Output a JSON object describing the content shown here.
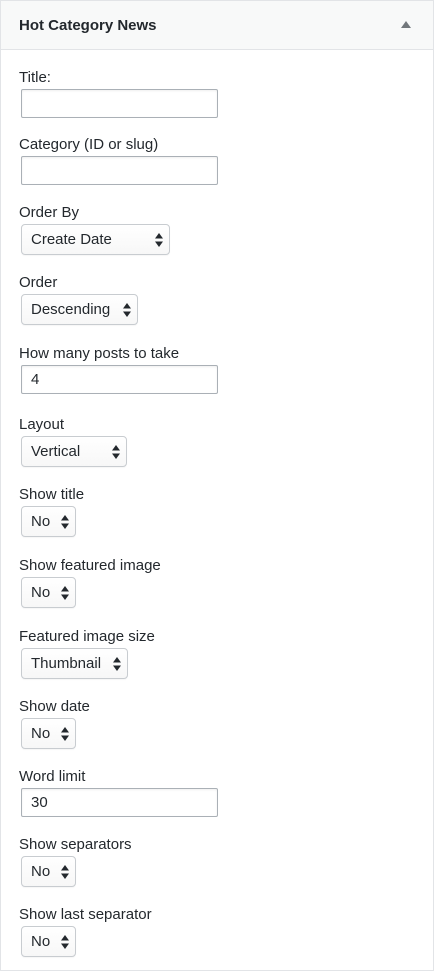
{
  "widget": {
    "title": "Hot Category News"
  },
  "fields": {
    "title": {
      "label": "Title:",
      "value": ""
    },
    "category": {
      "label": "Category (ID or slug)",
      "value": ""
    },
    "order_by": {
      "label": "Order By",
      "value": "Create Date"
    },
    "order": {
      "label": "Order",
      "value": "Descending"
    },
    "posts_count": {
      "label": "How many posts to take",
      "value": "4"
    },
    "layout": {
      "label": "Layout",
      "value": "Vertical"
    },
    "show_title": {
      "label": "Show title",
      "value": "No"
    },
    "show_featured_image": {
      "label": "Show featured image",
      "value": "No"
    },
    "featured_image_size": {
      "label": "Featured image size",
      "value": "Thumbnail"
    },
    "show_date": {
      "label": "Show date",
      "value": "No"
    },
    "word_limit": {
      "label": "Word limit",
      "value": "30"
    },
    "show_separators": {
      "label": "Show separators",
      "value": "No"
    },
    "show_last_separator": {
      "label": "Show last separator",
      "value": "No"
    }
  },
  "icons": {
    "collapse": "triangle-up-icon",
    "select_arrows": "up-down-arrows-icon"
  },
  "colors": {
    "header_bg": "#f8f9f9",
    "border": "#e2e4e7",
    "text": "#23282d",
    "arrow": "#72777c"
  }
}
